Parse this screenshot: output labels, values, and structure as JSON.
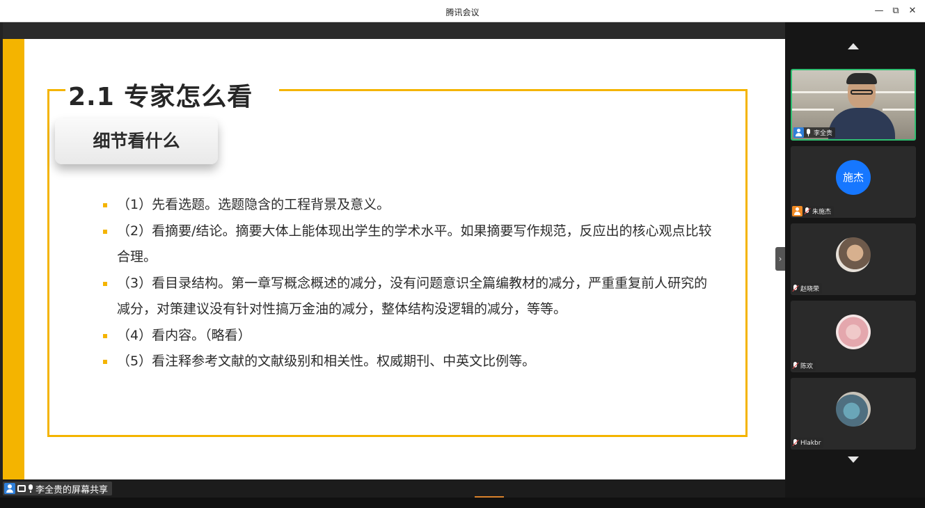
{
  "window": {
    "title": "腾讯会议",
    "min_icon": "—",
    "max_icon": "⧉",
    "close_icon": "✕"
  },
  "slide": {
    "title": "2.1 专家怎么看",
    "subtitle": "细节看什么",
    "bullets": [
      "（1）先看选题。选题隐含的工程背景及意义。",
      "（2）看摘要/结论。摘要大体上能体现出学生的学术水平。如果摘要写作规范，反应出的核心观点比较合理。",
      "（3）看目录结构。第一章写概念概述的减分，没有问题意识全篇编教材的减分，严重重复前人研究的减分，对策建议没有针对性搞万金油的减分，整体结构没逻辑的减分，等等。",
      "（4）看内容。（略看）",
      "（5）看注释参考文献的文献级别和相关性。权威期刊、中英文比例等。"
    ],
    "accent_color": "#f4b400"
  },
  "share": {
    "label": "李全贵的屏幕共享",
    "collapse_icon": "›"
  },
  "participants": [
    {
      "name": "李全贵",
      "kind": "video"
    },
    {
      "name": "朱施杰",
      "avatar_text": "施杰",
      "kind": "text-avatar"
    },
    {
      "name": "赵晓荣",
      "kind": "photo"
    },
    {
      "name": "陈欢",
      "kind": "photo"
    },
    {
      "name": "Hlakbr",
      "kind": "photo"
    }
  ]
}
